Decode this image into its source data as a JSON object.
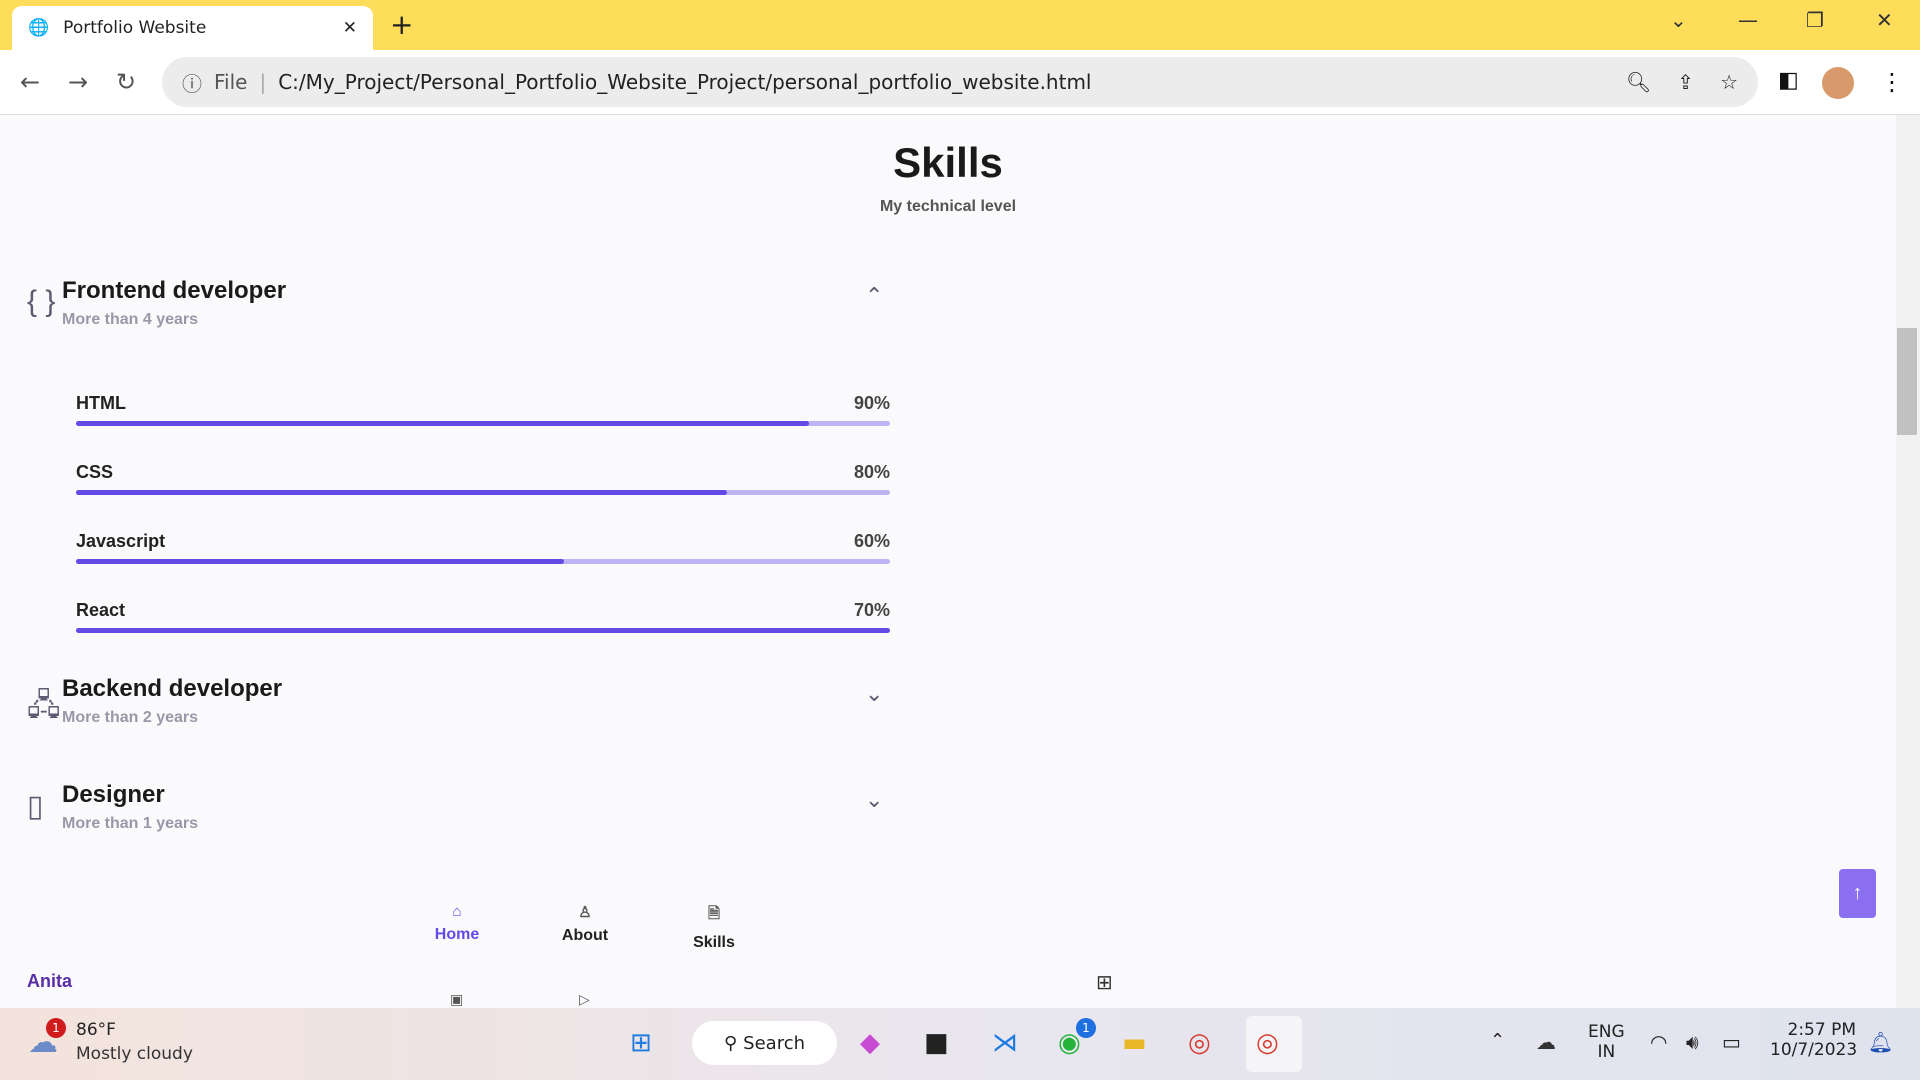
{
  "browser": {
    "tab_title": "Portfolio Website",
    "url_scheme": "File",
    "url": "C:/My_Project/Personal_Portfolio_Website_Project/personal_portfolio_website.html"
  },
  "page": {
    "title": "Skills",
    "subtitle": "My technical level"
  },
  "sections": [
    {
      "title": "Frontend developer",
      "subtitle": "More than 4 years",
      "icon": "braces-icon",
      "expanded": true,
      "skills": [
        {
          "name": "HTML",
          "percent_label": "90%",
          "value": 90
        },
        {
          "name": "CSS",
          "percent_label": "80%",
          "value": 80
        },
        {
          "name": "Javascript",
          "percent_label": "60%",
          "value": 60
        },
        {
          "name": "React",
          "percent_label": "70%",
          "value": 100
        }
      ]
    },
    {
      "title": "Backend developer",
      "subtitle": "More than 2 years",
      "icon": "server-icon",
      "expanded": false
    },
    {
      "title": "Designer",
      "subtitle": "More than 1 years",
      "icon": "swatchbook-icon",
      "expanded": false
    }
  ],
  "nav": {
    "items": [
      {
        "label": "Home",
        "active": true
      },
      {
        "label": "About"
      },
      {
        "label": "Skills"
      }
    ],
    "brand": "Anita"
  },
  "colors": {
    "accent": "#6449e7",
    "track": "#bdb5f3",
    "tabbar": "#fedd5b"
  },
  "taskbar": {
    "weather_temp": "86°F",
    "weather_desc": "Mostly cloudy",
    "weather_badge": "1",
    "search": "Search",
    "whatsapp_badge": "1",
    "lang1": "ENG",
    "lang2": "IN",
    "time": "2:57 PM",
    "date": "10/7/2023"
  }
}
